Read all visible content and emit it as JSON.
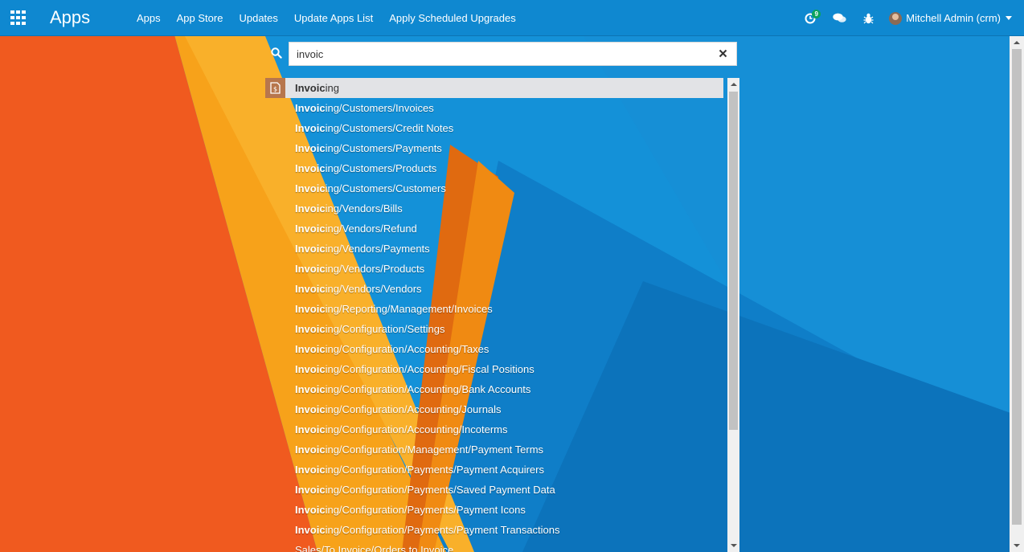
{
  "navbar": {
    "brand": "Apps",
    "menu": [
      "Apps",
      "App Store",
      "Updates",
      "Update Apps List",
      "Apply Scheduled Upgrades"
    ],
    "activity_count": "9",
    "user": "Mitchell Admin (crm)"
  },
  "search": {
    "value": "invoic"
  },
  "results": {
    "first": {
      "match": "Invoic",
      "rest": "ing"
    },
    "items": [
      {
        "match": "Invoic",
        "rest": "ing/Customers/Invoices"
      },
      {
        "match": "Invoic",
        "rest": "ing/Customers/Credit Notes"
      },
      {
        "match": "Invoic",
        "rest": "ing/Customers/Payments"
      },
      {
        "match": "Invoic",
        "rest": "ing/Customers/Products"
      },
      {
        "match": "Invoic",
        "rest": "ing/Customers/Customers"
      },
      {
        "match": "Invoic",
        "rest": "ing/Vendors/Bills"
      },
      {
        "match": "Invoic",
        "rest": "ing/Vendors/Refund"
      },
      {
        "match": "Invoic",
        "rest": "ing/Vendors/Payments"
      },
      {
        "match": "Invoic",
        "rest": "ing/Vendors/Products"
      },
      {
        "match": "Invoic",
        "rest": "ing/Vendors/Vendors"
      },
      {
        "match": "Invoic",
        "rest": "ing/Reporting/Management/Invoices"
      },
      {
        "match": "Invoic",
        "rest": "ing/Configuration/Settings"
      },
      {
        "match": "Invoic",
        "rest": "ing/Configuration/Accounting/Taxes"
      },
      {
        "match": "Invoic",
        "rest": "ing/Configuration/Accounting/Fiscal Positions"
      },
      {
        "match": "Invoic",
        "rest": "ing/Configuration/Accounting/Bank Accounts"
      },
      {
        "match": "Invoic",
        "rest": "ing/Configuration/Accounting/Journals"
      },
      {
        "match": "Invoic",
        "rest": "ing/Configuration/Accounting/Incoterms"
      },
      {
        "match": "Invoic",
        "rest": "ing/Configuration/Management/Payment Terms"
      },
      {
        "match": "Invoic",
        "rest": "ing/Configuration/Payments/Payment Acquirers"
      },
      {
        "match": "Invoic",
        "rest": "ing/Configuration/Payments/Saved Payment Data"
      },
      {
        "match": "Invoic",
        "rest": "ing/Configuration/Payments/Payment Icons"
      },
      {
        "match": "Invoic",
        "rest": "ing/Configuration/Payments/Payment Transactions"
      },
      {
        "match": "",
        "rest": "Sales/To Invoice/Orders to Invoice"
      }
    ]
  },
  "colors": {
    "navbar": "#0f88d0",
    "highlight_row": "#e2e3e6",
    "app_icon": "#b7764d",
    "badge": "#0aa35c",
    "bg_orange": "#f05a1f",
    "bg_yellow": "#f7a21a",
    "bg_blue": "#1491d8"
  },
  "icons": {
    "apps_menu": "grid-icon",
    "search": "search-icon",
    "clear": "close-icon",
    "activity": "clock-icon",
    "messages": "chat-icon",
    "debug": "bug-icon",
    "app": "invoice-icon"
  }
}
